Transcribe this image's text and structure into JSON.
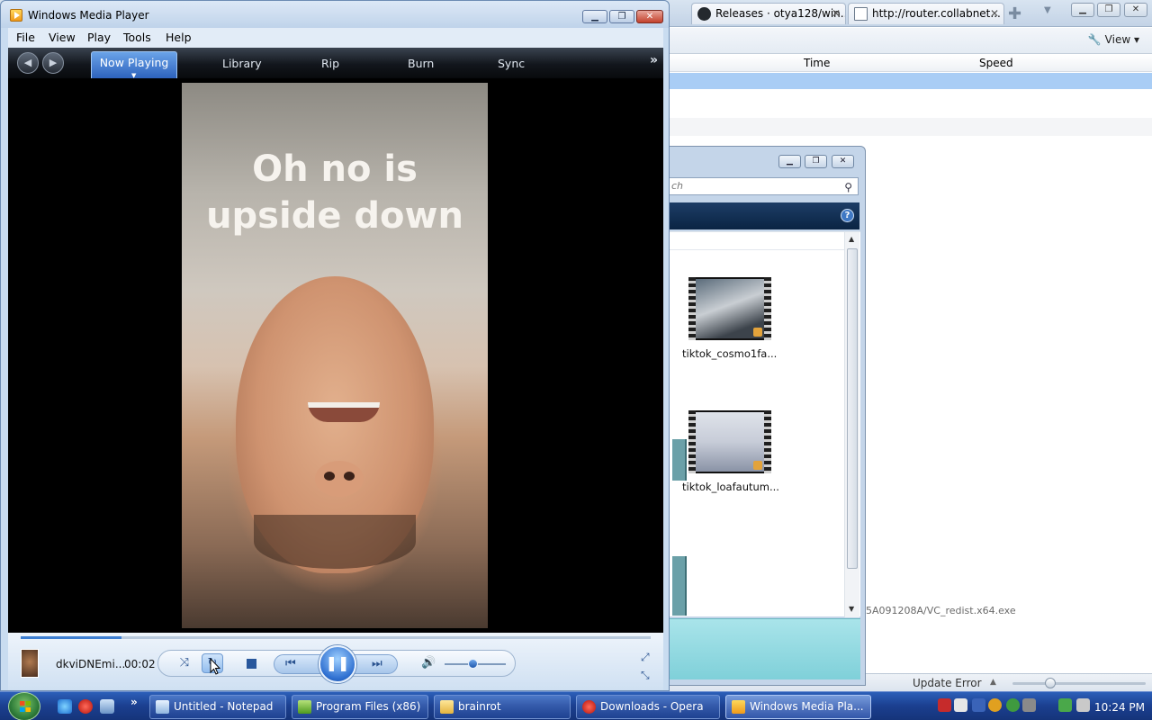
{
  "opera": {
    "tabs": [
      {
        "label": "Releases · otya128/win..."
      },
      {
        "label": "http://router.collabnet..."
      }
    ],
    "view_label": "View",
    "download_columns": {
      "time": "Time",
      "speed": "Speed"
    },
    "download_path": "5A091208A/VC_redist.x64.exe",
    "status_text": "Update Error"
  },
  "explorer": {
    "search_placeholder": "ch",
    "videos": [
      {
        "label": "tiktok_cosmo1fa..."
      },
      {
        "label": "tiktok_loafautum..."
      }
    ]
  },
  "wmp": {
    "title": "Windows Media Player",
    "menu": [
      "File",
      "View",
      "Play",
      "Tools",
      "Help"
    ],
    "tabs": {
      "now_playing": "Now Playing",
      "library": "Library",
      "rip": "Rip",
      "burn": "Burn",
      "sync": "Sync"
    },
    "video_caption_line1": "Oh no is",
    "video_caption_line2": "upside down",
    "track_name": "dkviDNEmi...",
    "elapsed": "00:02",
    "progress_fraction": 0.16,
    "volume_fraction": 0.45,
    "repeat_on": true,
    "state": "playing"
  },
  "taskbar": {
    "tasks": [
      {
        "label": "Untitled - Notepad"
      },
      {
        "label": "Program Files (x86)"
      },
      {
        "label": "brainrot"
      },
      {
        "label": "Downloads - Opera"
      },
      {
        "label": "Windows Media Pla..."
      }
    ],
    "clock": "10:24 PM"
  },
  "colors": {
    "wmp_accent": "#2e6fd0",
    "taskbar": "#1b3f8f",
    "download_selected": "#a9cdf5",
    "details_pane": "#7fd0d9"
  }
}
